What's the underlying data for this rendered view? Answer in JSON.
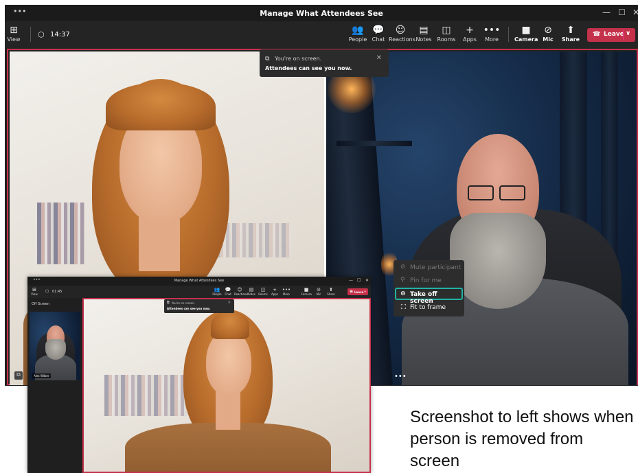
{
  "main_window": {
    "title": "Manage What Attendees See",
    "title_dots": "•••",
    "window_controls": {
      "minimize": "—",
      "maximize": "☐",
      "close": "✕"
    },
    "toolbar": {
      "view_label": "View",
      "timer": "14:37",
      "buttons": [
        {
          "label": "People",
          "icon": "people-icon"
        },
        {
          "label": "Chat",
          "icon": "chat-icon"
        },
        {
          "label": "Reactions",
          "icon": "reactions-icon"
        },
        {
          "label": "Notes",
          "icon": "notes-icon"
        },
        {
          "label": "Rooms",
          "icon": "rooms-icon"
        },
        {
          "label": "Apps",
          "icon": "apps-icon"
        },
        {
          "label": "More",
          "icon": "more-icon"
        },
        {
          "label": "Camera",
          "icon": "camera-icon"
        },
        {
          "label": "Mic",
          "icon": "mic-off-icon"
        },
        {
          "label": "Share",
          "icon": "share-icon"
        }
      ],
      "leave_label": "Leave"
    },
    "toast": {
      "line1": "You're on screen.",
      "line2": "Attendees can see you now."
    },
    "context_menu": {
      "items": [
        {
          "label": "Mute participant",
          "disabled": true
        },
        {
          "label": "Pin for me",
          "disabled": true
        },
        {
          "label": "Take off screen",
          "disabled": false,
          "selected": true
        },
        {
          "label": "Fit to frame",
          "disabled": false
        }
      ]
    },
    "more_dots": "•••"
  },
  "inset_window": {
    "title": "Manage What Attendees See",
    "timer": "01:45",
    "off_screen_label": "Off Screen",
    "thumbnail_name": "Alex Wilber",
    "toolbar": {
      "view_label": "View",
      "buttons": [
        "People",
        "Chat",
        "Reactions",
        "Notes",
        "Rooms",
        "Apps",
        "More",
        "Camera",
        "Mic",
        "Share"
      ],
      "leave_label": "Leave"
    },
    "toast": {
      "line1": "You're on screen.",
      "line2": "Attendees can see you now."
    }
  },
  "caption": "Screenshot to left shows when person is removed from screen",
  "colors": {
    "accent_red": "#c4314b",
    "highlight_teal": "#1fb4a5",
    "dark_bg": "#1f1f1f"
  }
}
